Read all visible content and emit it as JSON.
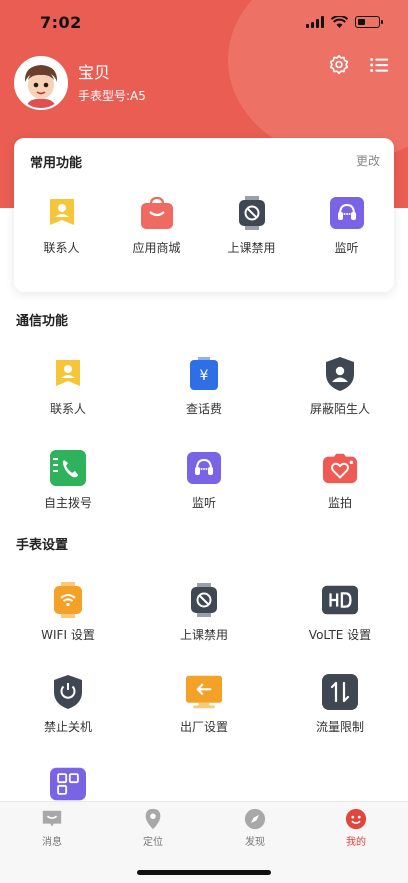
{
  "status_bar": {
    "time": "7:02"
  },
  "profile": {
    "name": "宝贝",
    "watch_model": "手表型号:A5"
  },
  "favorites": {
    "title": "常用功能",
    "edit_label": "更改",
    "items": [
      {
        "label": "联系人",
        "icon": "contacts-icon",
        "color": "#f5c53a"
      },
      {
        "label": "应用商城",
        "icon": "shopping-bag-icon",
        "color": "#ef6b62"
      },
      {
        "label": "上课禁用",
        "icon": "class-ban-icon",
        "color": "#3f4753"
      },
      {
        "label": "监听",
        "icon": "listen-icon",
        "color": "#7a64e6"
      }
    ]
  },
  "communication": {
    "title": "通信功能",
    "items": [
      {
        "label": "联系人",
        "icon": "contacts-icon",
        "color": "#f5c53a"
      },
      {
        "label": "查话费",
        "icon": "phone-bill-icon",
        "color": "#2f6fe6"
      },
      {
        "label": "屏蔽陌生人",
        "icon": "block-stranger-icon",
        "color": "#3f4753"
      },
      {
        "label": "自主拨号",
        "icon": "dial-icon",
        "color": "#2fb25c"
      },
      {
        "label": "监听",
        "icon": "listen-icon",
        "color": "#7a64e6"
      },
      {
        "label": "监拍",
        "icon": "remote-photo-icon",
        "color": "#ef5a55"
      }
    ]
  },
  "watch_settings": {
    "title": "手表设置",
    "items": [
      {
        "label": "WIFI 设置",
        "icon": "wifi-icon",
        "color": "#f3a227"
      },
      {
        "label": "上课禁用",
        "icon": "class-ban-icon",
        "color": "#3f4753"
      },
      {
        "label": "VoLTE 设置",
        "icon": "hd-icon",
        "color": "#3f4753"
      },
      {
        "label": "禁止关机",
        "icon": "power-lock-icon",
        "color": "#3f4753"
      },
      {
        "label": "出厂设置",
        "icon": "factory-reset-icon",
        "color": "#f3a227"
      },
      {
        "label": "流量限制",
        "icon": "data-limit-icon",
        "color": "#3f4753"
      },
      {
        "label": "",
        "icon": "qr-code-icon",
        "color": "#7a64e6"
      }
    ]
  },
  "tabbar": {
    "items": [
      {
        "label": "消息",
        "icon": "message-icon"
      },
      {
        "label": "定位",
        "icon": "location-icon"
      },
      {
        "label": "发现",
        "icon": "compass-icon"
      },
      {
        "label": "我的",
        "icon": "profile-icon",
        "active": true
      }
    ],
    "active_color": "#e0463c"
  },
  "theme": {
    "header_color": "#ea5d52"
  }
}
